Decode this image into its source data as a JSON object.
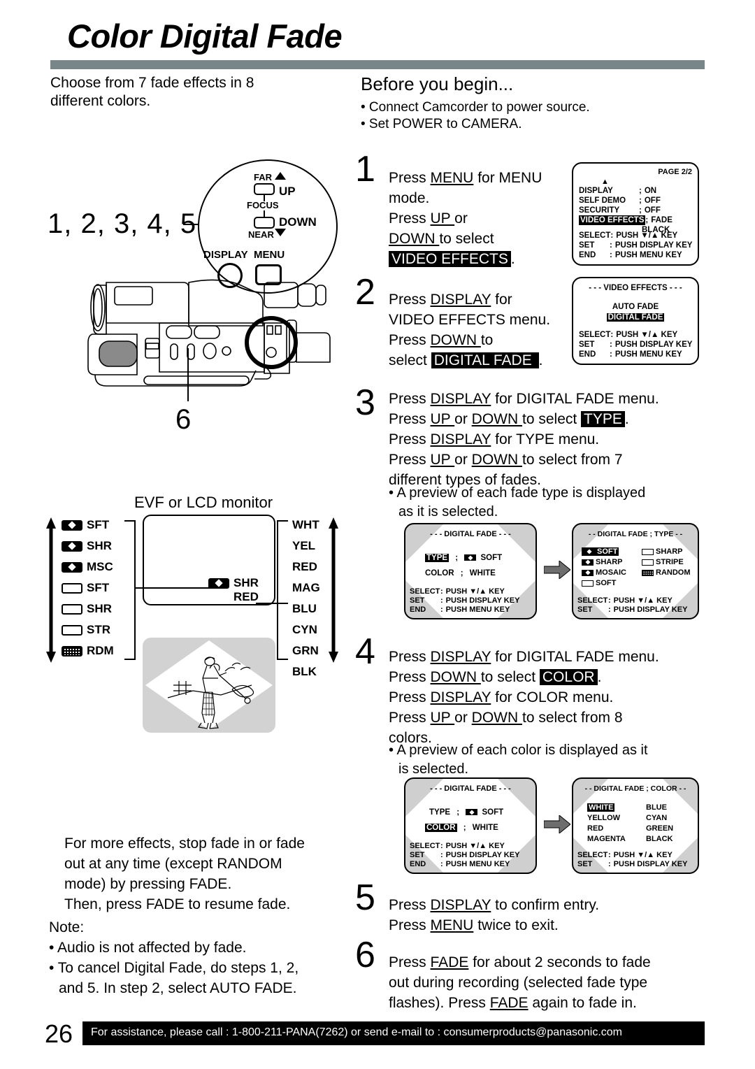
{
  "header": {
    "title": "Color Digital Fade",
    "rule_color": "#78868a"
  },
  "intro": {
    "line1": "Choose from 7 fade effects in 8",
    "line2": "different colors."
  },
  "before_you_begin": {
    "heading": "Before you begin...",
    "items": [
      "• Connect Camcorder to power source.",
      "• Set POWER to CAMERA."
    ]
  },
  "camcorder": {
    "step_group_label": "1, 2, 3, 4, 5",
    "fade_button_label": "6",
    "callout": {
      "far": "FAR",
      "up": "UP",
      "focus": "FOCUS",
      "down": "DOWN",
      "near": "NEAR",
      "display": "DISPLAY",
      "menu": "MENU"
    }
  },
  "evf_diagram": {
    "title": "EVF or LCD monitor",
    "fade_types": [
      {
        "label": "SFT",
        "icon": "filled-diamond-icon"
      },
      {
        "label": "SHR",
        "icon": "filled-diamond-icon"
      },
      {
        "label": "MSC",
        "icon": "filled-diamond-icon"
      },
      {
        "label": "SFT",
        "icon": "outline-box-icon"
      },
      {
        "label": "SHR",
        "icon": "outline-box-icon"
      },
      {
        "label": "STR",
        "icon": "outline-box-icon"
      },
      {
        "label": "RDM",
        "icon": "dotted-box-icon"
      }
    ],
    "colors": [
      "WHT",
      "YEL",
      "RED",
      "MAG",
      "BLU",
      "CYN",
      "GRN",
      "BLK"
    ],
    "osd_type": "SHR",
    "osd_color": "RED"
  },
  "steps": [
    {
      "number": "1",
      "lines": [
        [
          {
            "t": "Press "
          },
          {
            "t": "MENU",
            "s": "u"
          },
          {
            "t": " for MENU"
          }
        ],
        [
          {
            "t": "mode."
          }
        ],
        [
          {
            "t": "Press "
          },
          {
            "t": "UP  ",
            "s": "u"
          },
          {
            "t": " or"
          }
        ],
        [
          {
            "t": "DOWN  ",
            "s": "u"
          },
          {
            "t": " to select"
          }
        ],
        [
          {
            "t": "VIDEO EFFECTS",
            "s": "inv"
          },
          {
            "t": "."
          }
        ]
      ]
    },
    {
      "number": "2",
      "lines": [
        [
          {
            "t": "Press "
          },
          {
            "t": "DISPLAY",
            "s": "u"
          },
          {
            "t": " for"
          }
        ],
        [
          {
            "t": "VIDEO EFFECTS menu."
          }
        ],
        [
          {
            "t": "Press "
          },
          {
            "t": "DOWN  ",
            "s": "u"
          },
          {
            "t": " to"
          }
        ],
        [
          {
            "t": "select "
          },
          {
            "t": "DIGITAL FADE ",
            "s": "inv"
          },
          {
            "t": "."
          }
        ]
      ]
    },
    {
      "number": "3",
      "lines": [
        [
          {
            "t": "Press "
          },
          {
            "t": "DISPLAY",
            "s": "u"
          },
          {
            "t": " for DIGITAL FADE menu."
          }
        ],
        [
          {
            "t": "Press "
          },
          {
            "t": "UP  ",
            "s": "u"
          },
          {
            "t": " or "
          },
          {
            "t": "DOWN  ",
            "s": "u"
          },
          {
            "t": " to select "
          },
          {
            "t": "TYPE",
            "s": "inv"
          },
          {
            "t": "."
          }
        ],
        [
          {
            "t": "Press "
          },
          {
            "t": "DISPLAY",
            "s": "u"
          },
          {
            "t": " for TYPE menu."
          }
        ],
        [
          {
            "t": "Press "
          },
          {
            "t": "UP  ",
            "s": "u"
          },
          {
            "t": " or "
          },
          {
            "t": "DOWN  ",
            "s": "u"
          },
          {
            "t": " to select from 7"
          }
        ],
        [
          {
            "t": "different types of fades."
          }
        ]
      ],
      "bullet": [
        "• A preview of each fade type is displayed",
        "  as it is selected."
      ]
    },
    {
      "number": "4",
      "lines": [
        [
          {
            "t": "Press "
          },
          {
            "t": "DISPLAY",
            "s": "u"
          },
          {
            "t": " for DIGITAL FADE menu."
          }
        ],
        [
          {
            "t": "Press "
          },
          {
            "t": "DOWN  ",
            "s": "u"
          },
          {
            "t": " to select "
          },
          {
            "t": "COLOR",
            "s": "inv"
          },
          {
            "t": "."
          }
        ],
        [
          {
            "t": "Press "
          },
          {
            "t": "DISPLAY",
            "s": "u"
          },
          {
            "t": " for COLOR menu."
          }
        ],
        [
          {
            "t": "Press "
          },
          {
            "t": "UP  ",
            "s": "u"
          },
          {
            "t": " or "
          },
          {
            "t": "DOWN  ",
            "s": "u"
          },
          {
            "t": " to select from 8"
          }
        ],
        [
          {
            "t": "colors."
          }
        ]
      ],
      "bullet": [
        "• A preview of each color is displayed as it",
        "  is selected."
      ]
    },
    {
      "number": "5",
      "lines": [
        [
          {
            "t": "Press "
          },
          {
            "t": "DISPLAY",
            "s": "u"
          },
          {
            "t": " to confirm entry."
          }
        ],
        [
          {
            "t": "Press "
          },
          {
            "t": "MENU",
            "s": "u"
          },
          {
            "t": " twice to exit."
          }
        ]
      ]
    },
    {
      "number": "6",
      "lines": [
        [
          {
            "t": "Press "
          },
          {
            "t": "FADE",
            "s": "u"
          },
          {
            "t": " for about 2 seconds to fade"
          }
        ],
        [
          {
            "t": "out during recording (selected fade type"
          }
        ],
        [
          {
            "t": "flashes). Press "
          },
          {
            "t": "FADE",
            "s": "u"
          },
          {
            "t": " again  to fade in."
          }
        ]
      ]
    }
  ],
  "screens": {
    "menu_page2": {
      "page_label": "PAGE 2/2",
      "rows": [
        {
          "name": "DISPLAY",
          "sep": ";",
          "value": "ON"
        },
        {
          "name": "SELF DEMO",
          "sep": ";",
          "value": "OFF"
        },
        {
          "name": "SECURITY",
          "sep": ";",
          "value": "OFF"
        },
        {
          "name": "VIDEO EFFECTS",
          "sep": ";",
          "value": "FADE",
          "highlight": true
        },
        {
          "name": "",
          "sep": "",
          "value": "BLACK"
        }
      ],
      "footer": [
        {
          "k": "SELECT",
          "sep": ":",
          "v": "PUSH ▼/▲ KEY"
        },
        {
          "k": "SET",
          "sep": ":",
          "v": "PUSH DISPLAY KEY"
        },
        {
          "k": "END",
          "sep": ":",
          "v": "PUSH MENU KEY"
        }
      ]
    },
    "video_effects": {
      "title": "- - -  VIDEO  EFFECTS  - - -",
      "items": [
        {
          "label": "AUTO FADE",
          "highlight": false
        },
        {
          "label": "DIGITAL FADE",
          "highlight": true
        }
      ],
      "footer": [
        {
          "k": "SELECT",
          "sep": ":",
          "v": "PUSH ▼/▲ KEY"
        },
        {
          "k": "SET",
          "sep": ":",
          "v": "PUSH DISPLAY KEY"
        },
        {
          "k": "END",
          "sep": ":",
          "v": "PUSH MENU KEY"
        }
      ]
    },
    "digital_fade_type": {
      "title": "- - -  DIGITAL  FADE  - - -",
      "row_type_label": "TYPE",
      "row_type_sep": ";",
      "row_type_value": "SOFT",
      "row_type_highlight": true,
      "row_color_label": "COLOR",
      "row_color_sep": ";",
      "row_color_value": "WHITE",
      "row_color_highlight": false,
      "footer": [
        {
          "k": "SELECT",
          "sep": ":",
          "v": "PUSH ▼/▲ KEY"
        },
        {
          "k": "SET",
          "sep": ":",
          "v": "PUSH DISPLAY KEY"
        },
        {
          "k": "END",
          "sep": ":",
          "v": "PUSH MENU KEY"
        }
      ]
    },
    "type_list": {
      "title": "- -  DIGITAL  FADE  ; TYPE  - -",
      "left": [
        {
          "label": "SOFT",
          "icon": "filled-diamond-icon",
          "highlight": true
        },
        {
          "label": "SHARP",
          "icon": "filled-diamond-icon",
          "highlight": false
        },
        {
          "label": "MOSAIC",
          "icon": "filled-diamond-icon",
          "highlight": false
        },
        {
          "label": "SOFT",
          "icon": "outline-box-icon",
          "highlight": false
        }
      ],
      "right": [
        {
          "label": "SHARP",
          "icon": "outline-box-icon",
          "highlight": false
        },
        {
          "label": "STRIPE",
          "icon": "outline-box-icon",
          "highlight": false
        },
        {
          "label": "RANDOM",
          "icon": "dotted-box-icon",
          "highlight": false
        }
      ],
      "footer": [
        {
          "k": "SELECT",
          "sep": ":",
          "v": "PUSH ▼/▲ KEY"
        },
        {
          "k": "SET",
          "sep": ":",
          "v": "PUSH DISPLAY KEY"
        }
      ]
    },
    "digital_fade_color": {
      "title": "- - -  DIGITAL  FADE  - - -",
      "row_type_label": "TYPE",
      "row_type_sep": ";",
      "row_type_value": "SOFT",
      "row_type_highlight": false,
      "row_color_label": "COLOR",
      "row_color_sep": ";",
      "row_color_value": "WHITE",
      "row_color_highlight": true,
      "footer": [
        {
          "k": "SELECT",
          "sep": ":",
          "v": "PUSH ▼/▲ KEY"
        },
        {
          "k": "SET",
          "sep": ":",
          "v": "PUSH DISPLAY KEY"
        },
        {
          "k": "END",
          "sep": ":",
          "v": "PUSH MENU KEY"
        }
      ]
    },
    "color_list": {
      "title": "- -  DIGITAL  FADE  ; COLOR  - -",
      "left": [
        {
          "label": "WHITE",
          "highlight": true
        },
        {
          "label": "YELLOW",
          "highlight": false
        },
        {
          "label": "RED",
          "highlight": false
        },
        {
          "label": "MAGENTA",
          "highlight": false
        }
      ],
      "right": [
        {
          "label": "BLUE",
          "highlight": false
        },
        {
          "label": "CYAN",
          "highlight": false
        },
        {
          "label": "GREEN",
          "highlight": false
        },
        {
          "label": "BLACK",
          "highlight": false
        }
      ],
      "footer": [
        {
          "k": "SELECT",
          "sep": ":",
          "v": "PUSH ▼/▲ KEY"
        },
        {
          "k": "SET",
          "sep": ":",
          "v": "PUSH DISPLAY KEY"
        }
      ]
    }
  },
  "more_effects": [
    "For more effects, stop fade in or fade",
    "out at any time (except RANDOM",
    "mode) by pressing FADE.",
    "Then, press FADE to resume fade."
  ],
  "note": {
    "heading": "Note:",
    "items": [
      "• Audio is not affected by fade.",
      "• To cancel Digital Fade, do steps 1, 2,",
      "  and 5. In step 2, select AUTO FADE."
    ]
  },
  "footer": {
    "page_number": "26",
    "text": "For assistance, please call : 1-800-211-PANA(7262) or send e-mail to : consumerproducts@panasonic.com"
  }
}
